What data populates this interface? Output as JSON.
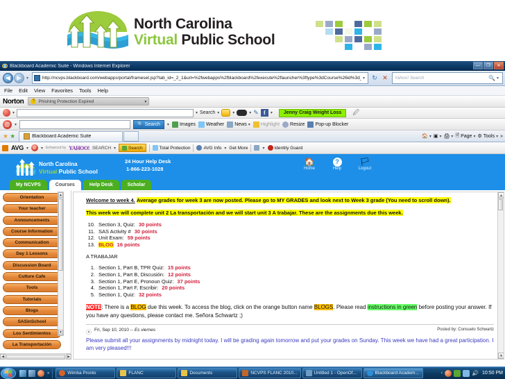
{
  "banner": {
    "line1": "North Carolina",
    "virtual": "Virtual",
    "public_school": " Public School"
  },
  "browser": {
    "window_title": "Blackboard Academic Suite - Windows Internet Explorer",
    "minimize_label": "—",
    "maximize_label": "❐",
    "close_label": "✕",
    "address_value": "http://ncvps.blackboard.com/webapps/portal/frameset.jsp?tab_id=_2_1&url=%2fwebapps%2fblackboard%2fexecute%2flauncher%3ftype%3dCourse%26id%3d_14",
    "address_caret": "▾",
    "refresh_icon": "↻",
    "stop_icon": "✕",
    "search_placeholder": "Yahoo! Search",
    "search_icon": "🔍",
    "search_caret": "▾",
    "back_icon": "◀",
    "forward_icon": "▶",
    "menu": [
      "File",
      "Edit",
      "View",
      "Favorites",
      "Tools",
      "Help"
    ]
  },
  "norton_bar": {
    "brand": "Norton",
    "status": "Phishing Protection Expired",
    "caret": "▾",
    "question_mark": "?"
  },
  "toolbar1": {
    "search_label": "Search",
    "caret": "▾",
    "ad_text": "Jenny Craig Weight Loss",
    "fb_label": "f",
    "pen_icon": "✎",
    "clip_icon": "🖉"
  },
  "toolbar2": {
    "search_button": "Search",
    "search_icon": "🔍",
    "caret": "▾",
    "items": [
      "Images",
      "Weather",
      "News",
      "Highlight",
      "Resize",
      "Pop-up Blocker"
    ]
  },
  "tab_strip": {
    "tab_label": "Blackboard Academic Suite",
    "right_items": [
      "Page",
      "Tools"
    ],
    "caret": "▾",
    "overflow": "»"
  },
  "avg_bar": {
    "brand": "AVG",
    "caret": "▾",
    "yahoo_prefix": "Enhanced by",
    "yahoo": "YAHOO!",
    "search_word": "SEARCH",
    "search_button": "Search",
    "items": [
      "Total Protection",
      "AVG Info",
      "Get More",
      "Identity Guard"
    ]
  },
  "blackboard": {
    "logo_line1": "North Carolina",
    "logo_virtual": "Virtual",
    "logo_public": " Public School",
    "helpdesk_title": "24 Hour Help Desk",
    "helpdesk_phone": "1-866-223-1028",
    "tools": [
      {
        "icon": "🏠",
        "label": "Home"
      },
      {
        "icon": "?",
        "label": "Help"
      },
      {
        "icon": "🏳",
        "label": "Logout"
      }
    ],
    "tabs": [
      {
        "label": "My NCVPS",
        "active": false
      },
      {
        "label": "Courses",
        "active": true
      },
      {
        "label": "Help Desk",
        "active": false
      },
      {
        "label": "Scholar",
        "active": false
      }
    ],
    "nav_buttons": [
      "Orientation",
      "Your teacher",
      "Announcements",
      "Course Information",
      "Communication",
      "Day 1 Lessons",
      "Discussion Board",
      "Culture Cafe",
      "Tools",
      "Tutorials",
      "Blogs",
      "SASinSchool",
      "Los Sentimientos",
      "La Transportación"
    ],
    "content": {
      "intro_lead": "Welcome to week 4.",
      "intro_highlight": "Average grades for week 3 are now posted. Please go to MY GRADES and look next to Week 3 grade (You need to scroll down).",
      "week_para": "This week we will complete unit 2 La transportación and we will start unit 3 A trabajar. These are the assignments due this week.",
      "due_list": [
        {
          "num": "10.",
          "text": "Section 3, Quiz:",
          "points": "30 points",
          "highlight": false
        },
        {
          "num": "11.",
          "text": "SAS Activity #",
          "points": "30 points",
          "highlight": false
        },
        {
          "num": "12.",
          "text": "Unit Exam:",
          "points": "59 points",
          "highlight": false
        },
        {
          "num": "13.",
          "text": "BLOG",
          "points": "16 points",
          "highlight": true
        }
      ],
      "trabajar_title": "A TRABAJAR",
      "trabajar_list": [
        {
          "num": "1.",
          "text": "Section 1, Part B, TPR Quiz:",
          "points": "15 points"
        },
        {
          "num": "2.",
          "text": "Section 1, Part B, Discusión:",
          "points": "12 points"
        },
        {
          "num": "3.",
          "text": "Section 1, Part E, Pronoun Quiz:",
          "points": "37 points"
        },
        {
          "num": "4.",
          "text": "Section 1, Part F, Escribir:",
          "points": "20 points"
        },
        {
          "num": "5.",
          "text": "Section 1, Quiz:",
          "points": "32 points"
        }
      ],
      "note_label": "NOTE",
      "note_p1": ": There is a ",
      "note_blog1": "BLOG",
      "note_p2": " due this week. To access the blog, click on the orange button name ",
      "note_blogs": "BLOGS",
      "note_p3": ". Please read ",
      "note_green": "instructions in green",
      "note_p4": " before posting your answer. If you have any questions, please contact me. Señora Schwartz ;)",
      "post_date": "Fri, Sep 10, 2010 -- ",
      "post_date_italic": "Es viernes",
      "post_by": "Posted by: Consuelo Schwartz",
      "post_body": "Please submit all your assignments by midnight today. I will be grading again tomorrow and put your grades on Sunday. This week we have had a great participation. I am very pleased!!!"
    }
  },
  "taskbar": {
    "start_icon": "⊞",
    "overflow": "»",
    "tasks": [
      {
        "label": "Wimba Pronto",
        "color": "#d2642a",
        "active": false
      },
      {
        "label": "FLANC",
        "color": "#e8c34a",
        "active": false
      },
      {
        "label": "Documents",
        "color": "#e8c34a",
        "active": false
      },
      {
        "label": "NCVPS FLANC 2010...",
        "color": "#c0672c",
        "active": false
      },
      {
        "label": "Untitled 1 - OpenOf...",
        "color": "#6d9bc3",
        "active": false
      },
      {
        "label": "Blackboard Academ...",
        "color": "#2d8fd5",
        "active": true
      }
    ],
    "tray_chevron": "‹",
    "clock": "10:50 PM"
  }
}
